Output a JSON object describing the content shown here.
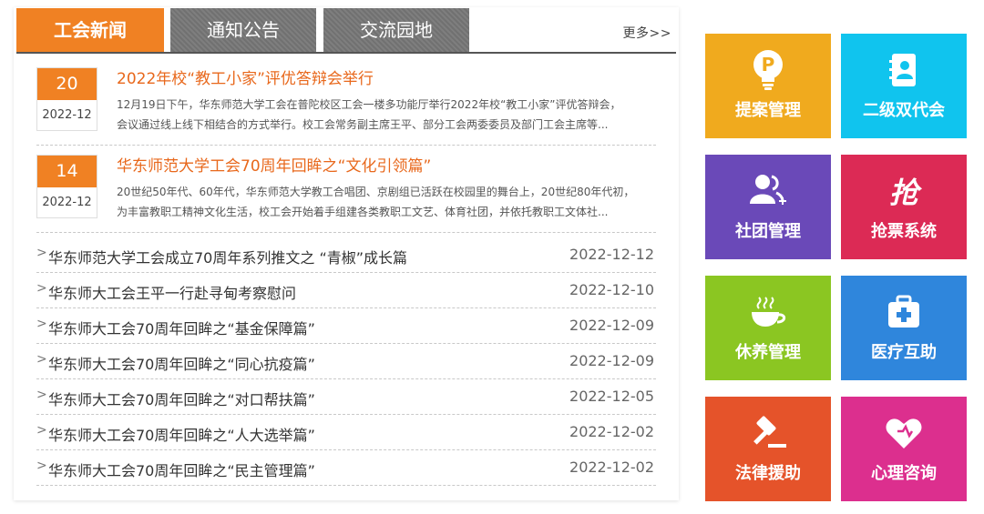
{
  "tabs": [
    {
      "label": "工会新闻"
    },
    {
      "label": "通知公告"
    },
    {
      "label": "交流园地"
    }
  ],
  "more_label": "更多>>",
  "featured": [
    {
      "day": "20",
      "year_month": "2022-12",
      "title": "2022年校“教工小家”评优答辩会举行",
      "line1": "12月19日下午，华东师范大学工会在普陀校区工会一楼多功能厅举行2022年校“教工小家”评优答辩会，",
      "line2": "会议通过线上线下相结合的方式举行。校工会常务副主席王平、部分工会两委委员及部门工会主席等..."
    },
    {
      "day": "14",
      "year_month": "2022-12",
      "title": "华东师范大学工会70周年回眸之“文化引领篇”",
      "line1": "20世纪50年代、60年代，华东师范大学教工合唱团、京剧组已活跃在校园里的舞台上，20世纪80年代初，",
      "line2": "为丰富教职工精神文化生活，校工会开始着手组建各类教职工文艺、体育社团，并依托教职工文体社..."
    }
  ],
  "news": [
    {
      "title": "华东师范大学工会成立70周年系列推文之 “青椒”成长篇",
      "date": "2022-12-12"
    },
    {
      "title": "华东师大工会王平一行赴寻甸考察慰问",
      "date": "2022-12-10"
    },
    {
      "title": "华东师大工会70周年回眸之“基金保障篇”",
      "date": "2022-12-09"
    },
    {
      "title": "华东师大工会70周年回眸之“同心抗疫篇”",
      "date": "2022-12-09"
    },
    {
      "title": "华东师大工会70周年回眸之“对口帮扶篇”",
      "date": "2022-12-05"
    },
    {
      "title": "华东师大工会70周年回眸之“人大选举篇”",
      "date": "2022-12-02"
    },
    {
      "title": "华东师大工会70周年回眸之“民主管理篇”",
      "date": "2022-12-02"
    }
  ],
  "row_arrow": ">",
  "tiles": [
    {
      "label": "提案管理",
      "icon": "proposal-bulb-icon",
      "color": "#f0aa1e",
      "glyph": "P"
    },
    {
      "label": "二级双代会",
      "icon": "contact-book-icon",
      "color": "#10c4ee"
    },
    {
      "label": "社团管理",
      "icon": "group-add-icon",
      "color": "#6a49b8"
    },
    {
      "label": "抢票系统",
      "icon": "grab-ticket-icon",
      "color": "#dc2a55",
      "glyph": "抢"
    },
    {
      "label": "休养管理",
      "icon": "coffee-cup-icon",
      "color": "#8bc622",
      "glyph": "≀≀≀"
    },
    {
      "label": "医疗互助",
      "icon": "medical-kit-icon",
      "color": "#2f86dc"
    },
    {
      "label": "法律援助",
      "icon": "gavel-icon",
      "color": "#e5532a"
    },
    {
      "label": "心理咨询",
      "icon": "heart-icon",
      "color": "#dc2f8e"
    }
  ],
  "colors": {
    "accent": "#f08123",
    "tab_inactive": "#777777",
    "title_link": "#e8681c"
  }
}
